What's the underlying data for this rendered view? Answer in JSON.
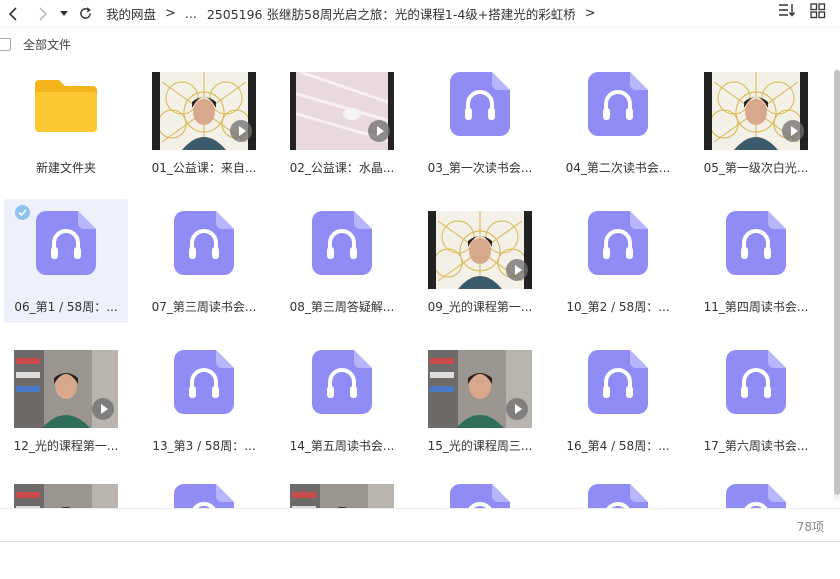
{
  "toolbar": {
    "back_icon": "chevron-left-icon",
    "forward_icon": "chevron-right-icon",
    "history_icon": "caret-down-icon",
    "refresh_icon": "refresh-icon",
    "breadcrumb": [
      "我的网盘",
      "...",
      "2505196 张继肪58周光启之旅：光的课程1-4级+搭建光的彩虹桥"
    ],
    "sort_icon": "sort-icon",
    "grid_view_icon": "grid-view-icon"
  },
  "subheader": {
    "select_all_label": "全部文件"
  },
  "files": [
    {
      "name": "新建文件夹",
      "type": "folder"
    },
    {
      "name": "01_公益课：来自...",
      "type": "video",
      "thumb": "geometry-bg"
    },
    {
      "name": "02_公益课：水晶...",
      "type": "video",
      "thumb": "pink-surface"
    },
    {
      "name": "03_第一次读书会...",
      "type": "audio"
    },
    {
      "name": "04_第二次读书会...",
      "type": "audio"
    },
    {
      "name": "05_第一级次白光...",
      "type": "video",
      "thumb": "geometry-bg"
    },
    {
      "name": "06_第1 / 58周：...",
      "type": "audio",
      "selected": true
    },
    {
      "name": "07_第三周读书会...",
      "type": "audio"
    },
    {
      "name": "08_第三周答疑解...",
      "type": "audio"
    },
    {
      "name": "09_光的课程第一...",
      "type": "video",
      "thumb": "geometry-bg"
    },
    {
      "name": "10_第2 / 58周：...",
      "type": "audio"
    },
    {
      "name": "11_第四周读书会...",
      "type": "audio"
    },
    {
      "name": "12_光的课程第一...",
      "type": "video",
      "thumb": "room-bg"
    },
    {
      "name": "13_第3 / 58周：...",
      "type": "audio"
    },
    {
      "name": "14_第五周读书会...",
      "type": "audio"
    },
    {
      "name": "15_光的课程周三...",
      "type": "video",
      "thumb": "room-bg"
    },
    {
      "name": "16_第4 / 58周：...",
      "type": "audio"
    },
    {
      "name": "17_第六周读书会...",
      "type": "audio"
    },
    {
      "name": "",
      "type": "video",
      "thumb": "room-bg"
    },
    {
      "name": "",
      "type": "audio"
    },
    {
      "name": "",
      "type": "video",
      "thumb": "room-bg"
    },
    {
      "name": "",
      "type": "audio"
    },
    {
      "name": "",
      "type": "audio"
    },
    {
      "name": "",
      "type": "audio"
    }
  ],
  "footer": {
    "item_count": "78项"
  },
  "colors": {
    "audio_icon": "#8f8cf6",
    "folder": "#fcc832",
    "selection_bg": "#eef1fb",
    "selected_check": "#8ec3ef"
  }
}
